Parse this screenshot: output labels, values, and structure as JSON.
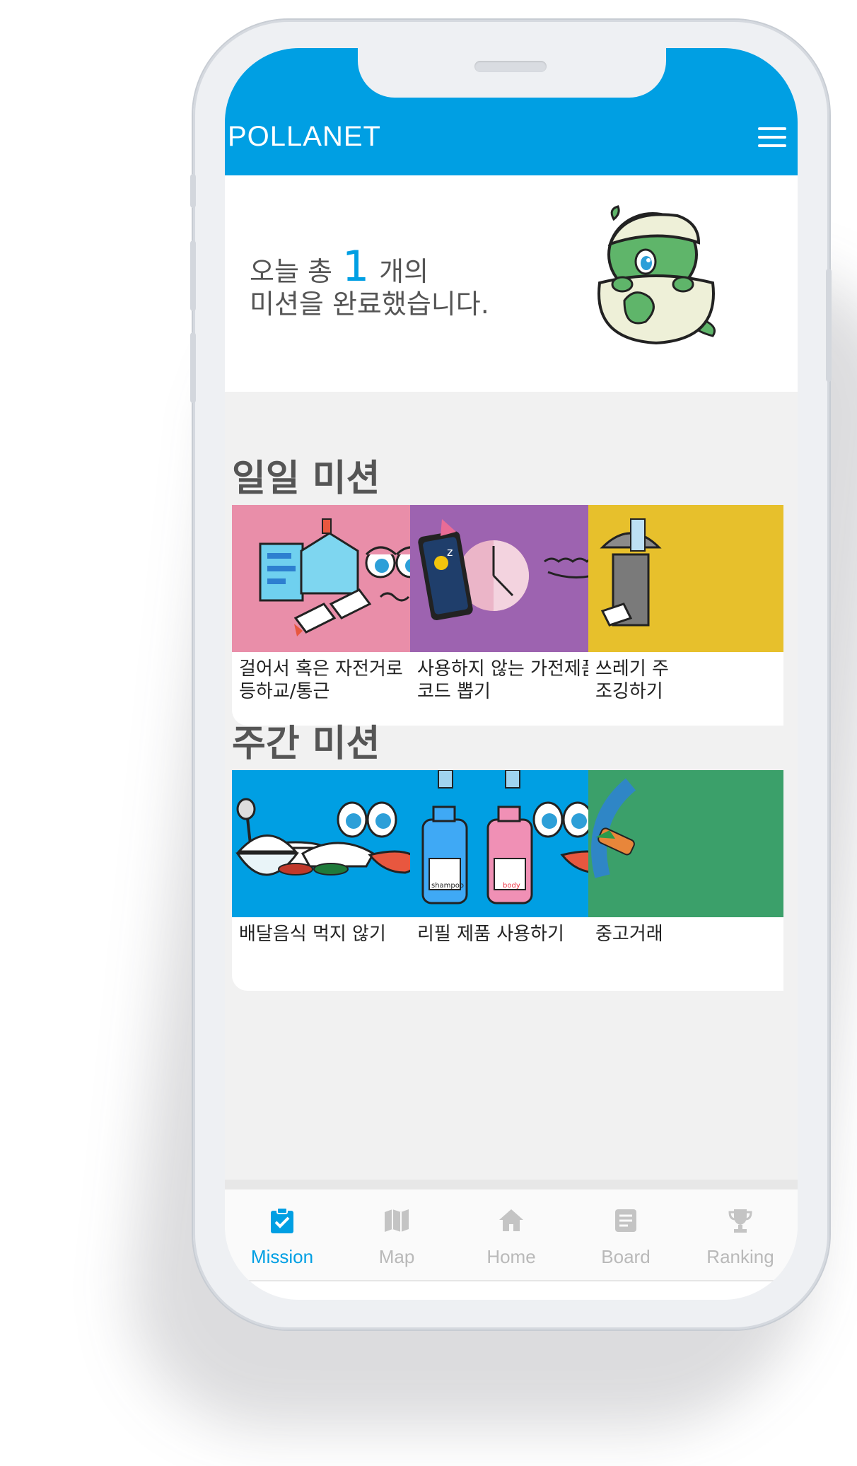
{
  "colors": {
    "primary": "#009fe3",
    "inactive": "#b9b9b9",
    "background": "#f1f1f1"
  },
  "header": {
    "brand": "POLLANET",
    "menu_icon": "hamburger-menu-icon"
  },
  "summary": {
    "prefix": "오늘 총",
    "count": "1",
    "unit": "개의",
    "line2": "미션을 완료했습니다."
  },
  "daily": {
    "title": "일일 미션",
    "missions": [
      {
        "label": "걸어서 혹은 자전거로\n등하교/통근",
        "art": "pink"
      },
      {
        "label": "사용하지 않는 가전제품\n코드 뽑기",
        "art": "purple"
      },
      {
        "label": "쓰레기 주\n조깅하기",
        "art": "yellow"
      }
    ]
  },
  "weekly": {
    "title": "주간 미션",
    "missions": [
      {
        "label": "배달음식 먹지 않기",
        "art": "blue"
      },
      {
        "label": "리필 제품 사용하기",
        "art": "blue"
      },
      {
        "label": "중고거래",
        "art": "green"
      }
    ]
  },
  "art_text": {
    "shampoo": "shampoo",
    "body": "body"
  },
  "nav": {
    "tabs": [
      {
        "label": "Mission",
        "icon": "clipboard-check-icon",
        "active": true
      },
      {
        "label": "Map",
        "icon": "map-icon",
        "active": false
      },
      {
        "label": "Home",
        "icon": "home-icon",
        "active": false
      },
      {
        "label": "Board",
        "icon": "document-icon",
        "active": false
      },
      {
        "label": "Ranking",
        "icon": "trophy-icon",
        "active": false
      }
    ]
  }
}
